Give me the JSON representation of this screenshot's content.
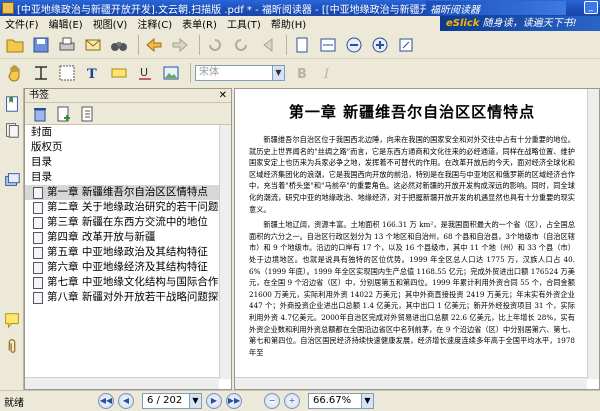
{
  "window": {
    "title": "[中亚地缘政治与新疆开放开发].文云朝.扫描版 .pdf * - 福昕阅读器 - [[中亚地缘政治与新疆开放开发].",
    "ad_text": "福昕阅读器"
  },
  "menubar": {
    "items": [
      "文件(F)",
      "编辑(E)",
      "视图(V)",
      "注释(C)",
      "表单(R)",
      "工具(T)",
      "帮助(H)"
    ],
    "promo_brand": "eSlick",
    "promo_text": "随身读，读遍天下书!"
  },
  "toolbar": {
    "font_placeholder": "宋体"
  },
  "bookmarks": {
    "header": "书签",
    "items": [
      {
        "label": "封面",
        "chapter": false
      },
      {
        "label": "版权页",
        "chapter": false
      },
      {
        "label": "目录",
        "chapter": false
      },
      {
        "label": "目录",
        "chapter": false
      },
      {
        "label": "第一章  新疆维吾尔自治区区情特点",
        "chapter": true,
        "selected": true
      },
      {
        "label": "第二章  关于地缘政治研究的若干问题",
        "chapter": true
      },
      {
        "label": "第三章  新疆在东西方交流中的地位",
        "chapter": true
      },
      {
        "label": "第四章  改革开放与新疆",
        "chapter": true
      },
      {
        "label": "第五章  中亚地缘政治及其结构特征",
        "chapter": true
      },
      {
        "label": "第六章  中亚地缘经济及其结构特征",
        "chapter": true
      },
      {
        "label": "第七章  中亚地缘文化结构与国际合作",
        "chapter": true
      },
      {
        "label": "第八章  新疆对外开放若干战略问题探讨",
        "chapter": true
      }
    ]
  },
  "document": {
    "heading": "第一章    新疆维吾尔自治区区情特点",
    "paragraphs": [
      "新疆维吾尔自治区位于我国西北边陲，向来在我国的国家安全和对外交往中占有十分重要的地位。就历史上世界闻名的\"丝绸之路\"而言，它是东西方通商和文化往来的必经通道，同样在战略位置、维护国家安定上也历来为兵家必争之地，发挥着不可替代的作用。在改革开放后的今天，面对经济全球化和区域经济集团化的浪潮，它是我国西向开放的前沿，特别是在我国与中亚地区和俄罗斯的区域经济合作中，充当着\"桥头堡\"和\"马前卒\"的重要角色。这必然对新疆的开放开发构成深远的影响。同时，同全球化的潮流，研究中亚的地缘政治、地缘经济，对于把握新疆开放开发的机遇显然也具有十分重要的现实意义。",
      "新疆土地辽阔，资源丰富。土地面积 166.31 万 km²，是我国面积最大的一个省（区），占全国总面积的六分之一。自治区行政区划分为 13 个地区和自治州，68 个县和自治县，3个地级市（自治区辖市）和 9 个地级市。沿边的口岸有 17 个，以及 16 个县级市，其中 11 个地（州）和 33 个县（市）处于边境地区。也就是说具有独特的区位优势。1999 年全区总人口达 1775 万，汉族人口占 40.6%（1999 年底）。1999 年全区实现国内生产总值 1168.55 亿元；完成外贸进出口额 176524 万美元，在全国 9 个沿边省（区）中，分别居第五和第四位。1999 年累计利用外资合同 55 个，合同金额 21600 万美元，实际利用外资 14022 万美元；其中外商直接投资 2419 万美元；年末实有外资企业 447 个；外商投资企业进出口总额 1.4 亿美元，其中出口 1 亿美元；新开外经投资项目 31 个，实际利用外资 4.7亿美元。2000年自治区完成对外贸易进出口总额 22.6 亿美元，比上年增长 28%，实有外资企业数和利用外资总额都在全国沿边省区中名列前茅，在 9 个沿边省（区）中分别居第六、第七、第七和第四位。自治区国民经济持续快速健康发展，经济增长速度连续多年高于全国平均水平，1978 年至"
    ]
  },
  "statusbar": {
    "status": "就绪",
    "page_value": "6 / 202",
    "zoom_value": "66.67%"
  },
  "colors": {
    "titlebar": "#1a4fb8",
    "chrome": "#ece9d8",
    "selected_row": "#d7d7d7"
  }
}
